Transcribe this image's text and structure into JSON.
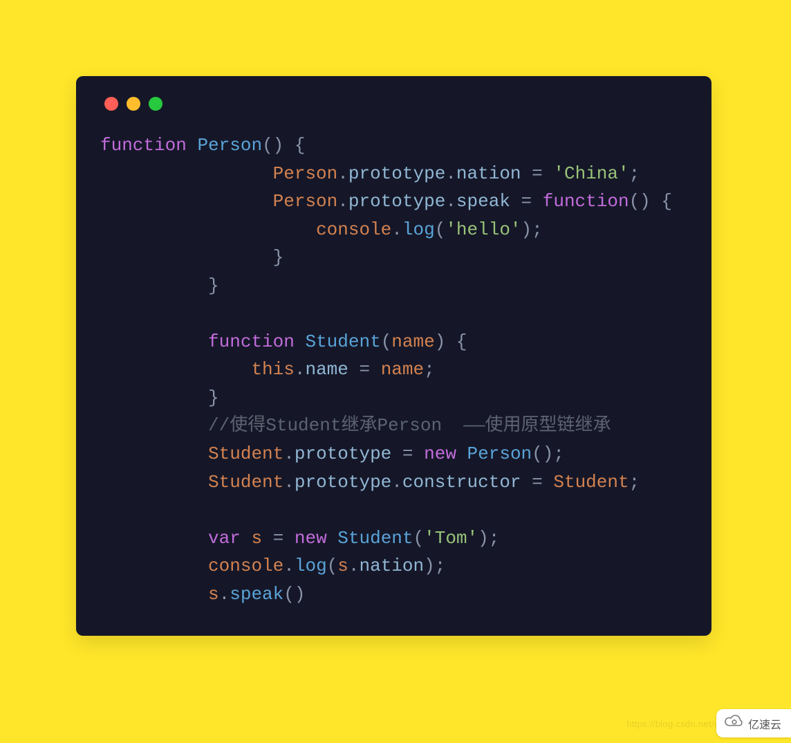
{
  "code": {
    "tokens": [
      [
        [
          "function",
          "c-key"
        ],
        [
          " ",
          "c-punc"
        ],
        [
          "Person",
          "c-func"
        ],
        [
          "() {",
          "c-punc"
        ]
      ],
      [
        [
          "                ",
          "c-punc"
        ],
        [
          "Person",
          "c-name"
        ],
        [
          ".",
          "c-punc"
        ],
        [
          "prototype",
          "c-prop"
        ],
        [
          ".",
          "c-punc"
        ],
        [
          "nation",
          "c-prop"
        ],
        [
          " = ",
          "c-punc"
        ],
        [
          "'China'",
          "c-str"
        ],
        [
          ";",
          "c-punc"
        ]
      ],
      [
        [
          "                ",
          "c-punc"
        ],
        [
          "Person",
          "c-name"
        ],
        [
          ".",
          "c-punc"
        ],
        [
          "prototype",
          "c-prop"
        ],
        [
          ".",
          "c-punc"
        ],
        [
          "speak",
          "c-prop"
        ],
        [
          " = ",
          "c-punc"
        ],
        [
          "function",
          "c-key"
        ],
        [
          "() {",
          "c-punc"
        ]
      ],
      [
        [
          "                    ",
          "c-punc"
        ],
        [
          "console",
          "c-name"
        ],
        [
          ".",
          "c-punc"
        ],
        [
          "log",
          "c-func"
        ],
        [
          "(",
          "c-punc"
        ],
        [
          "'hello'",
          "c-str"
        ],
        [
          ");",
          "c-punc"
        ]
      ],
      [
        [
          "                }",
          "c-punc"
        ]
      ],
      [
        [
          "          }",
          "c-punc"
        ]
      ],
      [
        [
          "",
          ""
        ]
      ],
      [
        [
          "          ",
          "c-punc"
        ],
        [
          "function",
          "c-key"
        ],
        [
          " ",
          "c-punc"
        ],
        [
          "Student",
          "c-func"
        ],
        [
          "(",
          "c-punc"
        ],
        [
          "name",
          "c-name"
        ],
        [
          ") {",
          "c-punc"
        ]
      ],
      [
        [
          "              ",
          "c-punc"
        ],
        [
          "this",
          "c-this"
        ],
        [
          ".",
          "c-punc"
        ],
        [
          "name",
          "c-prop"
        ],
        [
          " = ",
          "c-punc"
        ],
        [
          "name",
          "c-name"
        ],
        [
          ";",
          "c-punc"
        ]
      ],
      [
        [
          "          }",
          "c-punc"
        ]
      ],
      [
        [
          "          ",
          "c-punc"
        ],
        [
          "//使得Student继承Person  ——使用原型链继承",
          "c-com"
        ]
      ],
      [
        [
          "          ",
          "c-punc"
        ],
        [
          "Student",
          "c-name"
        ],
        [
          ".",
          "c-punc"
        ],
        [
          "prototype",
          "c-prop"
        ],
        [
          " = ",
          "c-punc"
        ],
        [
          "new",
          "c-new"
        ],
        [
          " ",
          "c-punc"
        ],
        [
          "Person",
          "c-func"
        ],
        [
          "();",
          "c-punc"
        ]
      ],
      [
        [
          "          ",
          "c-punc"
        ],
        [
          "Student",
          "c-name"
        ],
        [
          ".",
          "c-punc"
        ],
        [
          "prototype",
          "c-prop"
        ],
        [
          ".",
          "c-punc"
        ],
        [
          "constructor",
          "c-prop"
        ],
        [
          " = ",
          "c-punc"
        ],
        [
          "Student",
          "c-name"
        ],
        [
          ";",
          "c-punc"
        ]
      ],
      [
        [
          "",
          ""
        ]
      ],
      [
        [
          "          ",
          "c-punc"
        ],
        [
          "var",
          "c-key"
        ],
        [
          " ",
          "c-punc"
        ],
        [
          "s",
          "c-var"
        ],
        [
          " = ",
          "c-punc"
        ],
        [
          "new",
          "c-new"
        ],
        [
          " ",
          "c-punc"
        ],
        [
          "Student",
          "c-func"
        ],
        [
          "(",
          "c-punc"
        ],
        [
          "'Tom'",
          "c-str"
        ],
        [
          ");",
          "c-punc"
        ]
      ],
      [
        [
          "          ",
          "c-punc"
        ],
        [
          "console",
          "c-name"
        ],
        [
          ".",
          "c-punc"
        ],
        [
          "log",
          "c-func"
        ],
        [
          "(",
          "c-punc"
        ],
        [
          "s",
          "c-var"
        ],
        [
          ".",
          "c-punc"
        ],
        [
          "nation",
          "c-prop"
        ],
        [
          ");",
          "c-punc"
        ]
      ],
      [
        [
          "          ",
          "c-punc"
        ],
        [
          "s",
          "c-var"
        ],
        [
          ".",
          "c-punc"
        ],
        [
          "speak",
          "c-func"
        ],
        [
          "()",
          "c-punc"
        ]
      ]
    ]
  },
  "watermark": "https://blog.csdn.net/m",
  "badge": {
    "label": "亿速云"
  },
  "traffic": {
    "red": "close-icon",
    "yellow": "minimize-icon",
    "green": "zoom-icon"
  }
}
